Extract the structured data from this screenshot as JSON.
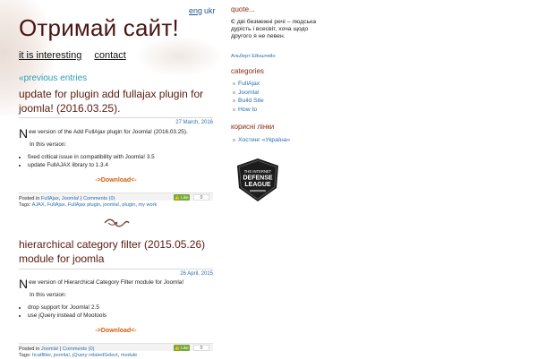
{
  "header": {
    "site_title": "Отримай сайт!",
    "lang_eng": "eng",
    "lang_ukr": "ukr",
    "nav": [
      "it is interesting",
      "contact"
    ]
  },
  "main": {
    "previous_entries": "previous entries",
    "posts": [
      {
        "title": "update for plugin add fullajax plugin for joomla! (2016.03.25).",
        "date": "27 March, 2016",
        "dropcap": "N",
        "intro": "ew version of the Add FullAjax plugin for Joomla! (2016.03.25).",
        "subhead": "In this version:",
        "items": [
          "fixed critical issue in compatibility with Joomla! 3.5",
          "update FullAJAX library to 1.3.4"
        ],
        "download_label": "Download",
        "like_label": "Like",
        "like_count": "0",
        "posted_in_label": "Posted in",
        "categories": [
          "FullAjax",
          "Joomla!"
        ],
        "comments": "Comments (0)",
        "tags_label": "Tags:",
        "tags": [
          "AJAX",
          "FullAjax",
          "FullAjax plugin",
          "joomla!",
          "plugin",
          "my work"
        ]
      },
      {
        "title": "hierarchical category filter (2015.05.26) module for joomla",
        "date": "26 April, 2015",
        "dropcap": "N",
        "intro": "ew version of Hierarchical Category Filter module for Joomla!",
        "subhead": "In this version:",
        "items": [
          "drop support for Joomla! 2.5",
          "use jQuery instead of Mootools"
        ],
        "download_label": "Download",
        "like_label": "Like",
        "like_count": "0",
        "posted_in_label": "Posted in",
        "categories": [
          "Joomla!"
        ],
        "comments": "Comments (0)",
        "tags_label": "Tags:",
        "tags": [
          "hcatfilter",
          "joomla!",
          "jQuery relatedSelect",
          "module"
        ]
      }
    ]
  },
  "sidebar": {
    "quote_heading": "quote...",
    "quote_text": "Є дві безмежні речі – людська дурість і всесвіт, хоча щодо другого я не певен.",
    "quote_author": "Альберт Ейнштейн",
    "categories_heading": "categories",
    "categories": [
      "FullAjax",
      "Joomla!",
      "Build Site",
      "How to"
    ],
    "links_heading": "корисні лінки",
    "links": [
      "Хостинг «Україна»"
    ],
    "badge_lines": [
      "THE INTERNET",
      "DEFENSE",
      "LEAGUE"
    ]
  }
}
